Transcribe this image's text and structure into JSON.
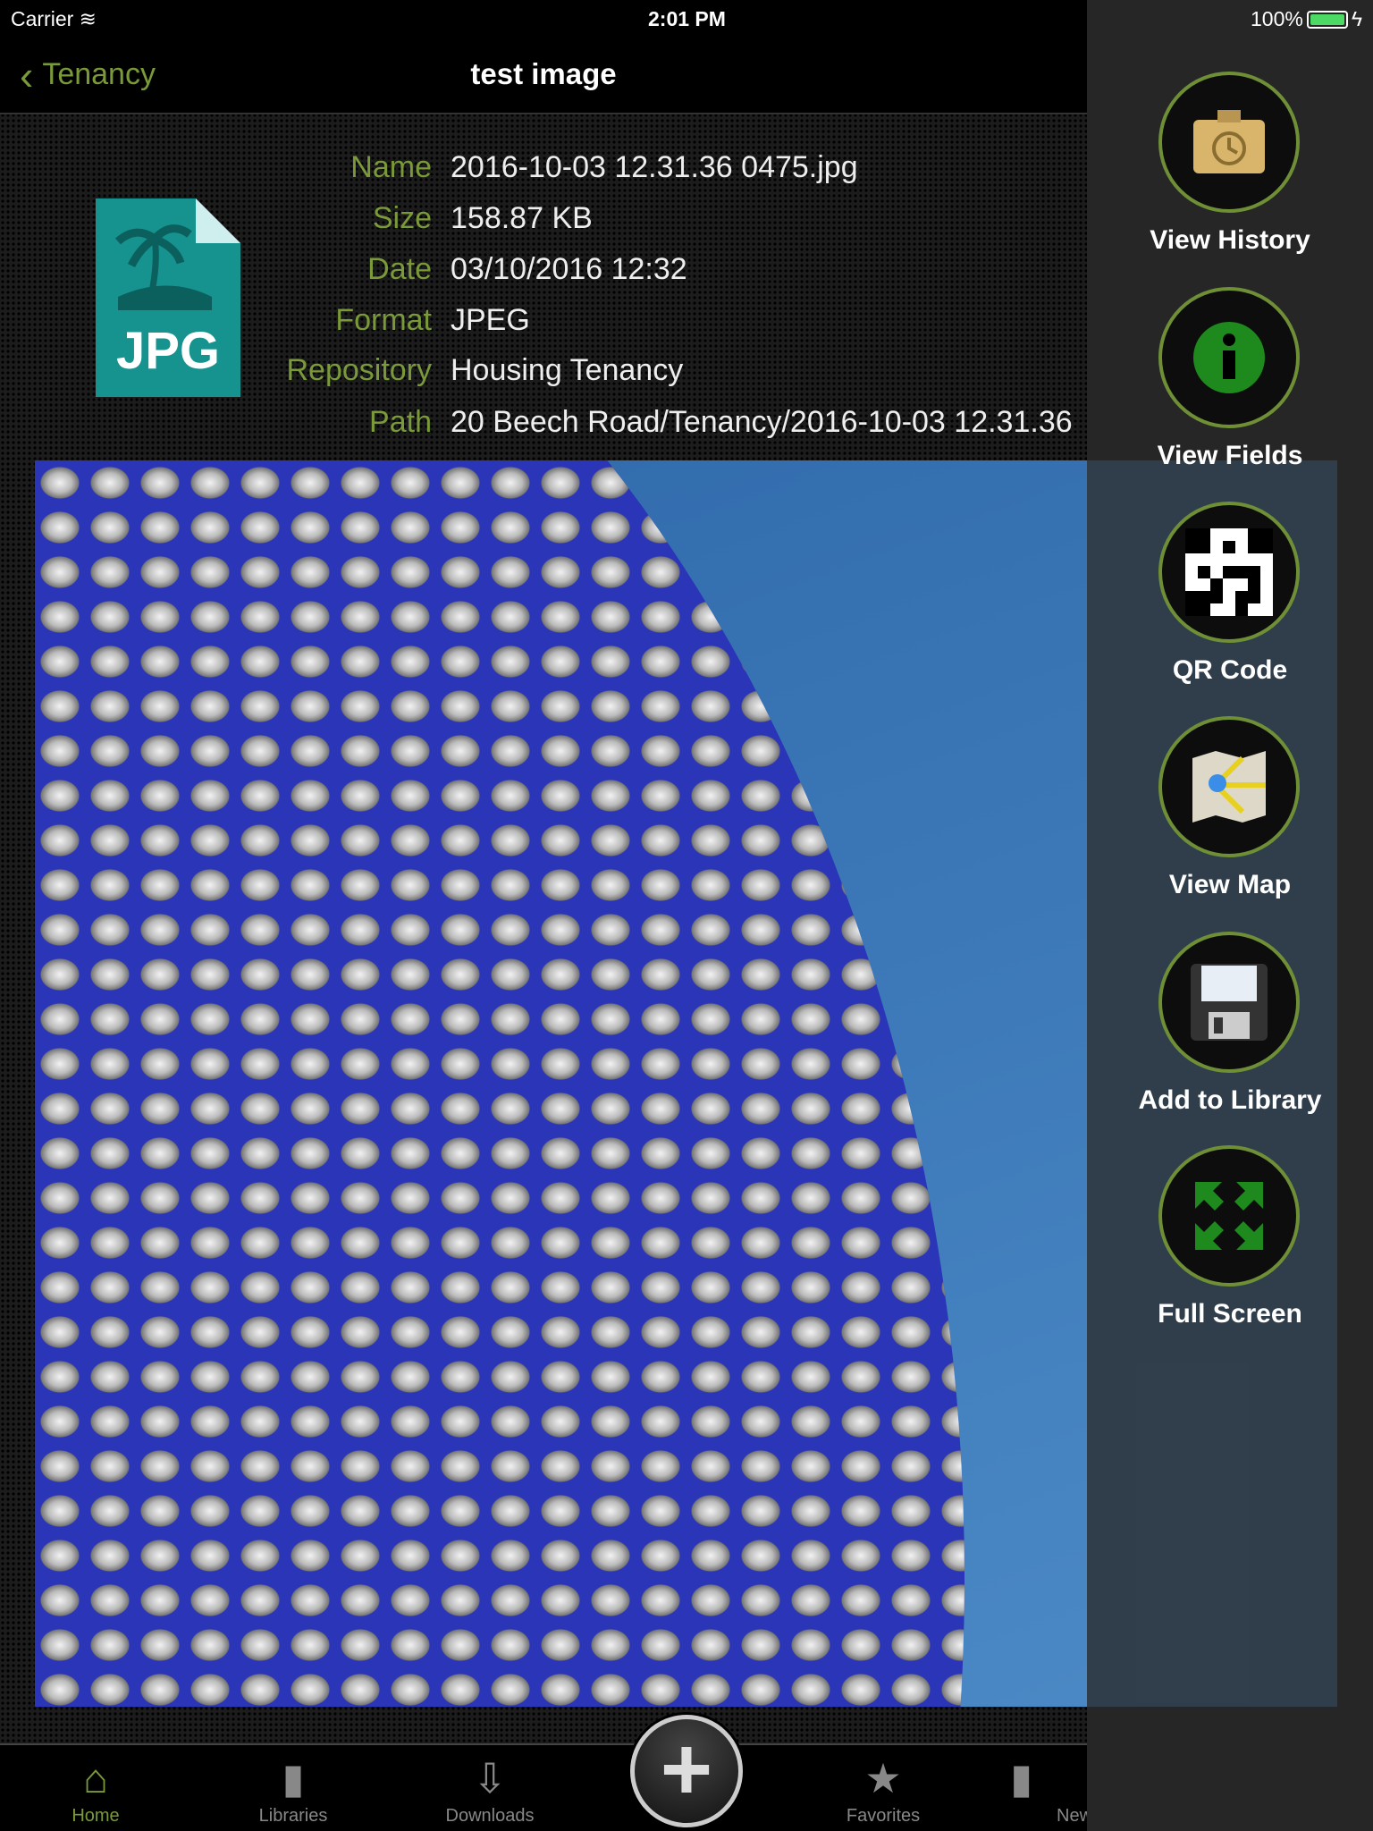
{
  "status": {
    "carrier": "Carrier",
    "time": "2:01 PM",
    "battery": "100%"
  },
  "nav": {
    "back_label": "Tenancy",
    "title": "test image"
  },
  "file": {
    "icon_label": "JPG",
    "fields": [
      {
        "key": "Name",
        "value": "2016-10-03 12.31.36 0475.jpg"
      },
      {
        "key": "Size",
        "value": "158.87 KB"
      },
      {
        "key": "Date",
        "value": "03/10/2016 12:32"
      },
      {
        "key": "Format",
        "value": "JPEG"
      },
      {
        "key": "Repository",
        "value": "Housing Tenancy"
      },
      {
        "key": "Path",
        "value": "20 Beech Road/Tenancy/2016-10-03 12.31.36"
      }
    ]
  },
  "tabs": [
    {
      "label": "Home",
      "icon": "home-icon"
    },
    {
      "label": "Libraries",
      "icon": "folder-icon"
    },
    {
      "label": "Downloads",
      "icon": "download-icon"
    },
    {
      "label": "Favorites",
      "icon": "star-icon"
    },
    {
      "label": "New",
      "icon": "folder-icon"
    }
  ],
  "drawer": {
    "items": [
      {
        "label": "View History",
        "icon": "history-icon"
      },
      {
        "label": "View Fields",
        "icon": "info-icon"
      },
      {
        "label": "QR Code",
        "icon": "qr-code-icon"
      },
      {
        "label": "View Map",
        "icon": "map-icon"
      },
      {
        "label": "Add to Library",
        "icon": "floppy-disk-icon"
      },
      {
        "label": "Full Screen",
        "icon": "fullscreen-icon"
      }
    ]
  },
  "colors": {
    "accent": "#7a9a3a",
    "ring": "#6e8f36",
    "teal": "#1a8a8a"
  }
}
